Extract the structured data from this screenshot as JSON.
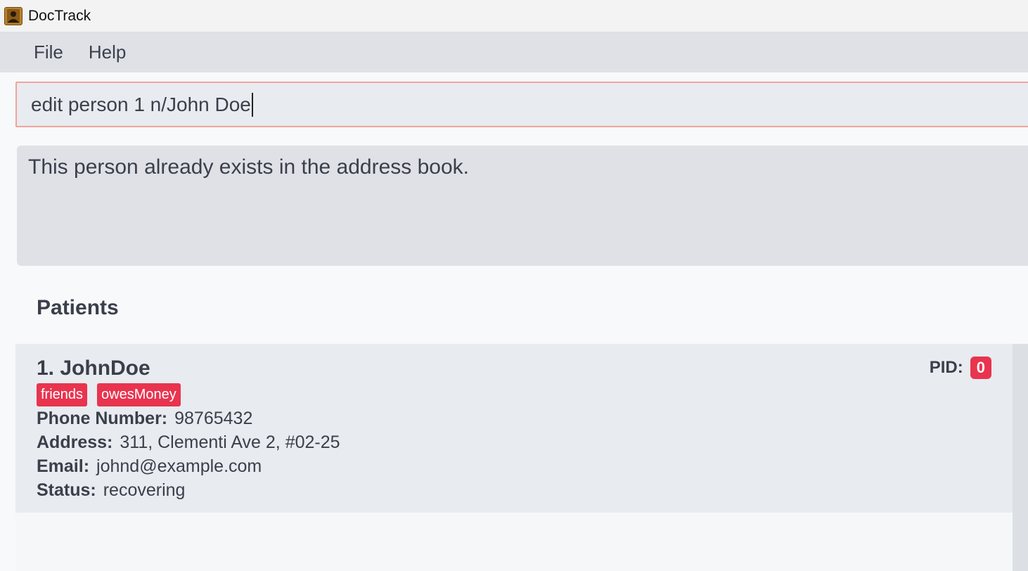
{
  "window": {
    "title": "DocTrack",
    "icon": "address-book-icon"
  },
  "menu": {
    "items": [
      "File",
      "Help"
    ]
  },
  "command": {
    "value": "edit person 1 n/John Doe"
  },
  "result": {
    "message": "This person already exists in the address book."
  },
  "panel": {
    "title": "Patients"
  },
  "persons": [
    {
      "index_name": "1. JohnDoe",
      "pid_label": "PID:",
      "pid": "0",
      "tags": [
        "friends",
        "owesMoney"
      ],
      "fields": [
        {
          "label": "Phone Number:",
          "value": "98765432"
        },
        {
          "label": "Address:",
          "value": "311, Clementi Ave 2, #02-25"
        },
        {
          "label": "Email:",
          "value": "johnd@example.com"
        },
        {
          "label": "Status:",
          "value": "recovering"
        }
      ]
    }
  ],
  "colors": {
    "tag": "#e8344f",
    "command_border": "#f2a49b"
  }
}
